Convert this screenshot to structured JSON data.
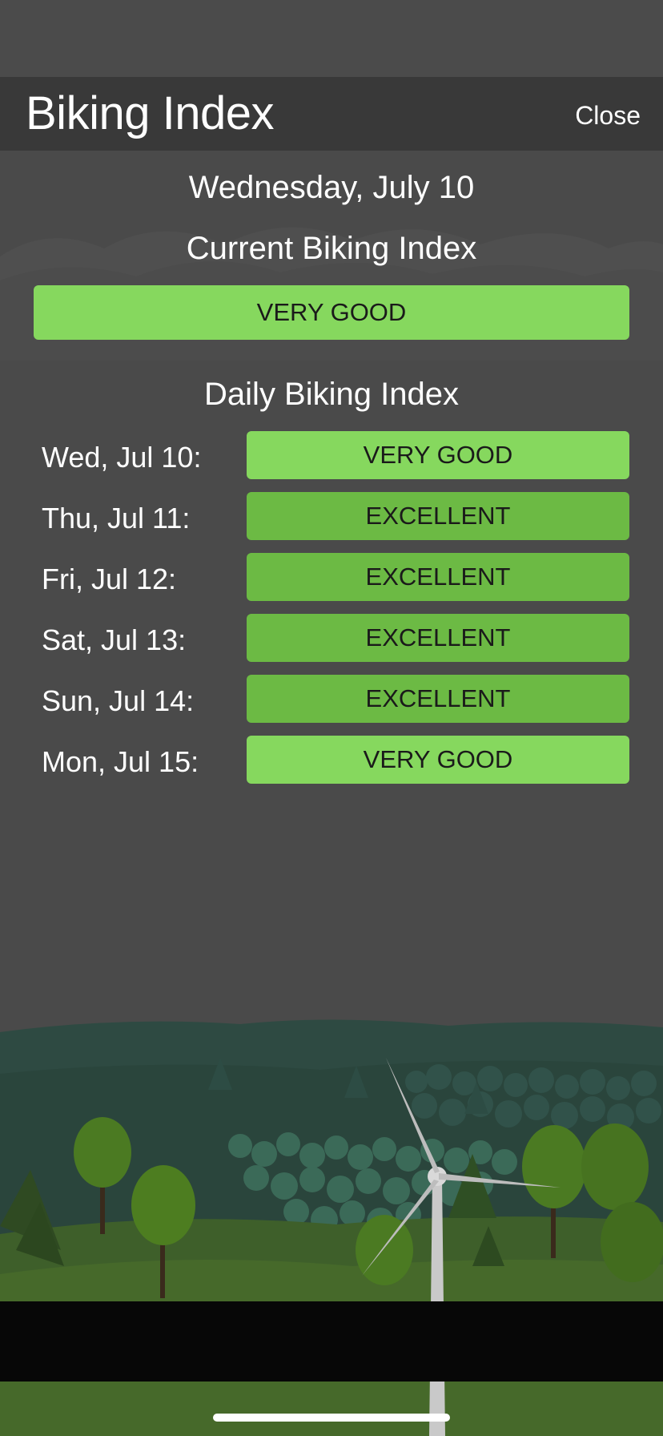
{
  "header": {
    "title": "Biking Index",
    "close_label": "Close"
  },
  "date": "Wednesday, July 10",
  "current": {
    "title": "Current Biking Index",
    "rating": "VERY GOOD",
    "color": "#86d85e"
  },
  "daily": {
    "title": "Daily Biking Index",
    "days": [
      {
        "label": "Wed, Jul 10:",
        "rating": "VERY GOOD",
        "color": "#86d85e"
      },
      {
        "label": "Thu, Jul 11:",
        "rating": "EXCELLENT",
        "color": "#6cba44"
      },
      {
        "label": "Fri, Jul 12:",
        "rating": "EXCELLENT",
        "color": "#6cba44"
      },
      {
        "label": "Sat, Jul 13:",
        "rating": "EXCELLENT",
        "color": "#6cba44"
      },
      {
        "label": "Sun, Jul 14:",
        "rating": "EXCELLENT",
        "color": "#6cba44"
      },
      {
        "label": "Mon, Jul 15:",
        "rating": "VERY GOOD",
        "color": "#86d85e"
      }
    ]
  },
  "colors": {
    "background": "#4a4a4a",
    "header_bg": "#393939",
    "very_good": "#86d85e",
    "excellent": "#6cba44"
  }
}
